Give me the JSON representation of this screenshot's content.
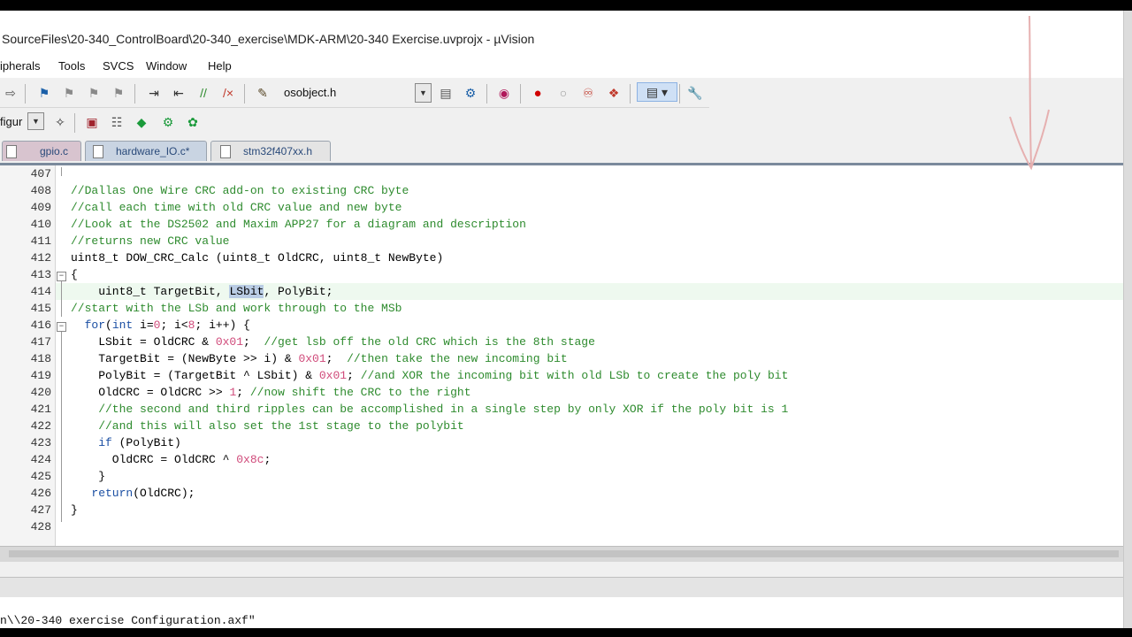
{
  "window": {
    "title": "SourceFiles\\20-340_ControlBoard\\20-340_exercise\\MDK-ARM\\20-340 Exercise.uvprojx - µVision"
  },
  "menu": [
    "ipherals",
    "Tools",
    "SVCS",
    "Window",
    "Help"
  ],
  "toolbar": {
    "file_combo": "osobject.h",
    "config_combo": "figur"
  },
  "tabs": [
    {
      "label": "gpio.c",
      "active": false
    },
    {
      "label": "hardware_IO.c*",
      "active": true
    },
    {
      "label": "stm32f407xx.h",
      "active": false
    }
  ],
  "editor": {
    "line_numbers": [
      "407",
      "408",
      "409",
      "410",
      "411",
      "412",
      "413",
      "414",
      "415",
      "416",
      "417",
      "418",
      "419",
      "420",
      "421",
      "422",
      "423",
      "424",
      "425",
      "426",
      "427",
      "428"
    ],
    "current_line": "414",
    "selected_text": "LSbit"
  },
  "code": {
    "l407": "",
    "l408": "//Dallas One Wire CRC add-on to existing CRC byte",
    "l409": "//call each time with old CRC value and new byte",
    "l410": "//Look at the DS2502 and Maxim APP27 for a diagram and description",
    "l411": "//returns new CRC value",
    "l412": "uint8_t DOW_CRC_Calc (uint8_t OldCRC, uint8_t NewByte)",
    "l413": "{",
    "l414_a": "    uint8_t TargetBit, ",
    "l414_sel": "LSbit",
    "l414_b": ", PolyBit;",
    "l415": "//start with the LSb and work through to the MSb",
    "l416_kw": "for",
    "l416_a": "(",
    "l416_kw2": "int",
    "l416_b": " i=",
    "l416_n1": "0",
    "l416_c": "; i<",
    "l416_n2": "8",
    "l416_d": "; i++) {",
    "l417_a": "    LSbit = OldCRC & ",
    "l417_n": "0x01",
    "l417_b": ";  ",
    "l417_c": "//get lsb off the old CRC which is the 8th stage",
    "l418_a": "    TargetBit = (NewByte >> i) & ",
    "l418_n": "0x01",
    "l418_b": ";  ",
    "l418_c": "//then take the new incoming bit",
    "l419_a": "    PolyBit = (TargetBit ^ LSbit) & ",
    "l419_n": "0x01",
    "l419_b": "; ",
    "l419_c": "//and XOR the incoming bit with old LSb to create the poly bit",
    "l420_a": "    OldCRC = OldCRC >> ",
    "l420_n": "1",
    "l420_b": "; ",
    "l420_c": "//now shift the CRC to the right",
    "l421": "    //the second and third ripples can be accomplished in a single step by only XOR if the poly bit is 1",
    "l422": "    //and this will also set the 1st stage to the polybit",
    "l423_kw": "if",
    "l423_a": " (PolyBit)",
    "l424_a": "      OldCRC = OldCRC ^ ",
    "l424_n": "0x8c",
    "l424_b": ";",
    "l425": "    }",
    "l426_kw": "return",
    "l426_a": "(OldCRC);",
    "l427": "}",
    "l428": ""
  },
  "output": {
    "text": "n\\\\20-340 exercise Configuration.axf\""
  }
}
